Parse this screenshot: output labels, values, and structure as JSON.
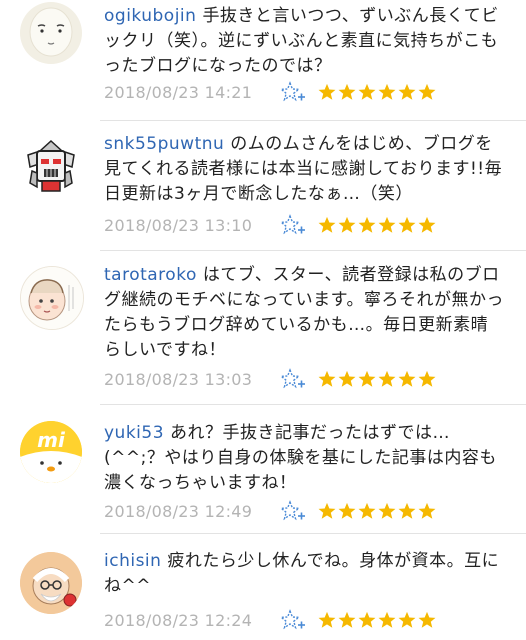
{
  "colors": {
    "username": "#2f66b3",
    "timestamp": "#b4b4b4",
    "star": "#f5b800",
    "add_star": "#4a8ad6"
  },
  "comments": [
    {
      "username": "ogikubojin",
      "text": "手抜きと言いつつ、ずいぶん長くてビックリ（笑）。逆にずいぶんと素直に気持ちがこもったブログになったのでは？",
      "timestamp": "2018/08/23 14:21",
      "star_count": 6,
      "avatar_icon": "white-face-avatar-icon"
    },
    {
      "username": "snk55puwtnu",
      "text": "のムのムさんをはじめ、ブログを見てくれる読者様には本当に感謝しております!!毎日更新は3ヶ月で断念したなぁ…（笑）",
      "timestamp": "2018/08/23 13:10",
      "star_count": 6,
      "avatar_icon": "robot-head-avatar-icon"
    },
    {
      "username": "tarotaroko",
      "text": "はてブ、スター、読者登録は私のブログ継続のモチベになっています。寧ろそれが無かったらもうブログ辞めているかも…。毎日更新素晴らしいですね！",
      "timestamp": "2018/08/23 13:03",
      "star_count": 6,
      "avatar_icon": "baby-drawing-avatar-icon"
    },
    {
      "username": "yuki53",
      "text": "あれ？手抜き記事だったはずでは…(^^;？やはり自身の体験を基にした記事は内容も濃くなっちゃいますね！",
      "timestamp": "2018/08/23 12:49",
      "star_count": 6,
      "avatar_icon": "yellow-chick-avatar-icon"
    },
    {
      "username": "ichisin",
      "text": "疲れたら少し休んでね。身体が資本。互にね^^",
      "timestamp": "2018/08/23 12:24",
      "star_count": 6,
      "avatar_icon": "old-man-avatar-icon"
    }
  ]
}
